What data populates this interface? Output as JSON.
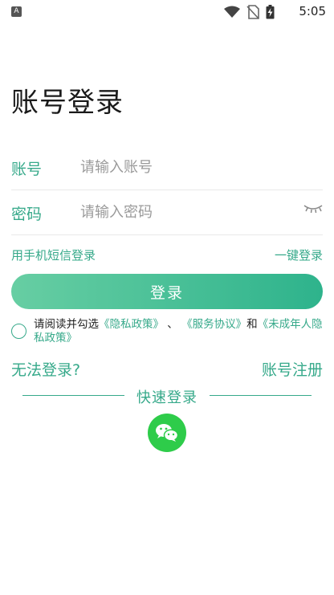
{
  "status_bar": {
    "app_icon_letter": "A",
    "time": "5:05",
    "icons": [
      "wifi-icon",
      "no-sim-icon",
      "battery-charging-icon"
    ]
  },
  "page_title": "账号登录",
  "account": {
    "label": "账号",
    "placeholder": "请输入账号"
  },
  "password": {
    "label": "密码",
    "placeholder": "请输入密码",
    "toggle_icon": "eye-closed-icon"
  },
  "links": {
    "sms_login": "用手机短信登录",
    "onekey_login": "一键登录"
  },
  "login_button": "登录",
  "agreement": {
    "prefix": "请阅读并勾选",
    "privacy": "《隐私政策》",
    "sep1": "、",
    "service": "《服务协议》",
    "and": "和",
    "minor_privacy": "《未成年人隐私政策》",
    "checked": false
  },
  "bottom": {
    "cannot_login": "无法登录?",
    "register": "账号注册"
  },
  "quick_login": {
    "label": "快速登录",
    "wechat_icon": "wechat-icon"
  },
  "colors": {
    "accent": "#36a98a",
    "button_start": "#67cea3",
    "button_end": "#2eb38c",
    "wechat": "#2ecc4a"
  }
}
